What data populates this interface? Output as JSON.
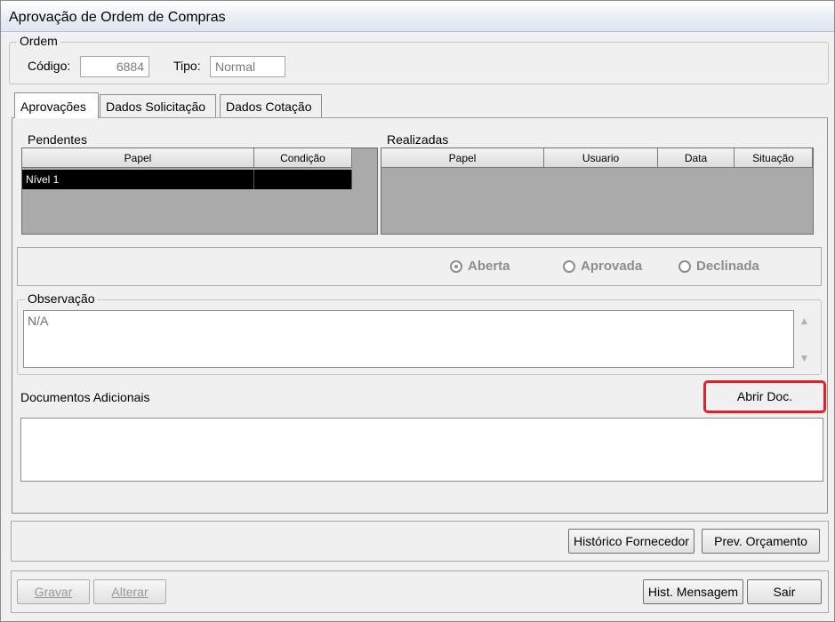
{
  "window": {
    "title": "Aprovação de Ordem de Compras"
  },
  "ordem": {
    "legend": "Ordem",
    "codigo_label": "Código:",
    "codigo_value": "6884",
    "tipo_label": "Tipo:",
    "tipo_value": "Normal"
  },
  "tabs": [
    {
      "label": "Aprovações",
      "active": true
    },
    {
      "label": "Dados Solicitação",
      "active": false
    },
    {
      "label": "Dados Cotação",
      "active": false
    }
  ],
  "pendentes": {
    "label": "Pendentes",
    "columns": [
      "Papel",
      "Condição"
    ],
    "rows": [
      [
        "Nível 1",
        ""
      ]
    ]
  },
  "realizadas": {
    "label": "Realizadas",
    "columns": [
      "Papel",
      "Usuario",
      "Data",
      "Situação"
    ],
    "rows": []
  },
  "status": {
    "options": [
      {
        "label": "Aberta",
        "checked": true
      },
      {
        "label": "Aprovada",
        "checked": false
      },
      {
        "label": "Declinada",
        "checked": false
      }
    ]
  },
  "observacao": {
    "legend": "Observação",
    "value": "N/A"
  },
  "documentos": {
    "label": "Documentos Adicionais",
    "open_button": "Abrir Doc."
  },
  "actions": {
    "historico_fornecedor": "Histórico Fornecedor",
    "prev_orcamento": "Prev. Orçamento"
  },
  "footer": {
    "gravar": "Gravar",
    "alterar": "Alterar",
    "hist_mensagem": "Hist. Mensagem",
    "sair": "Sair"
  }
}
